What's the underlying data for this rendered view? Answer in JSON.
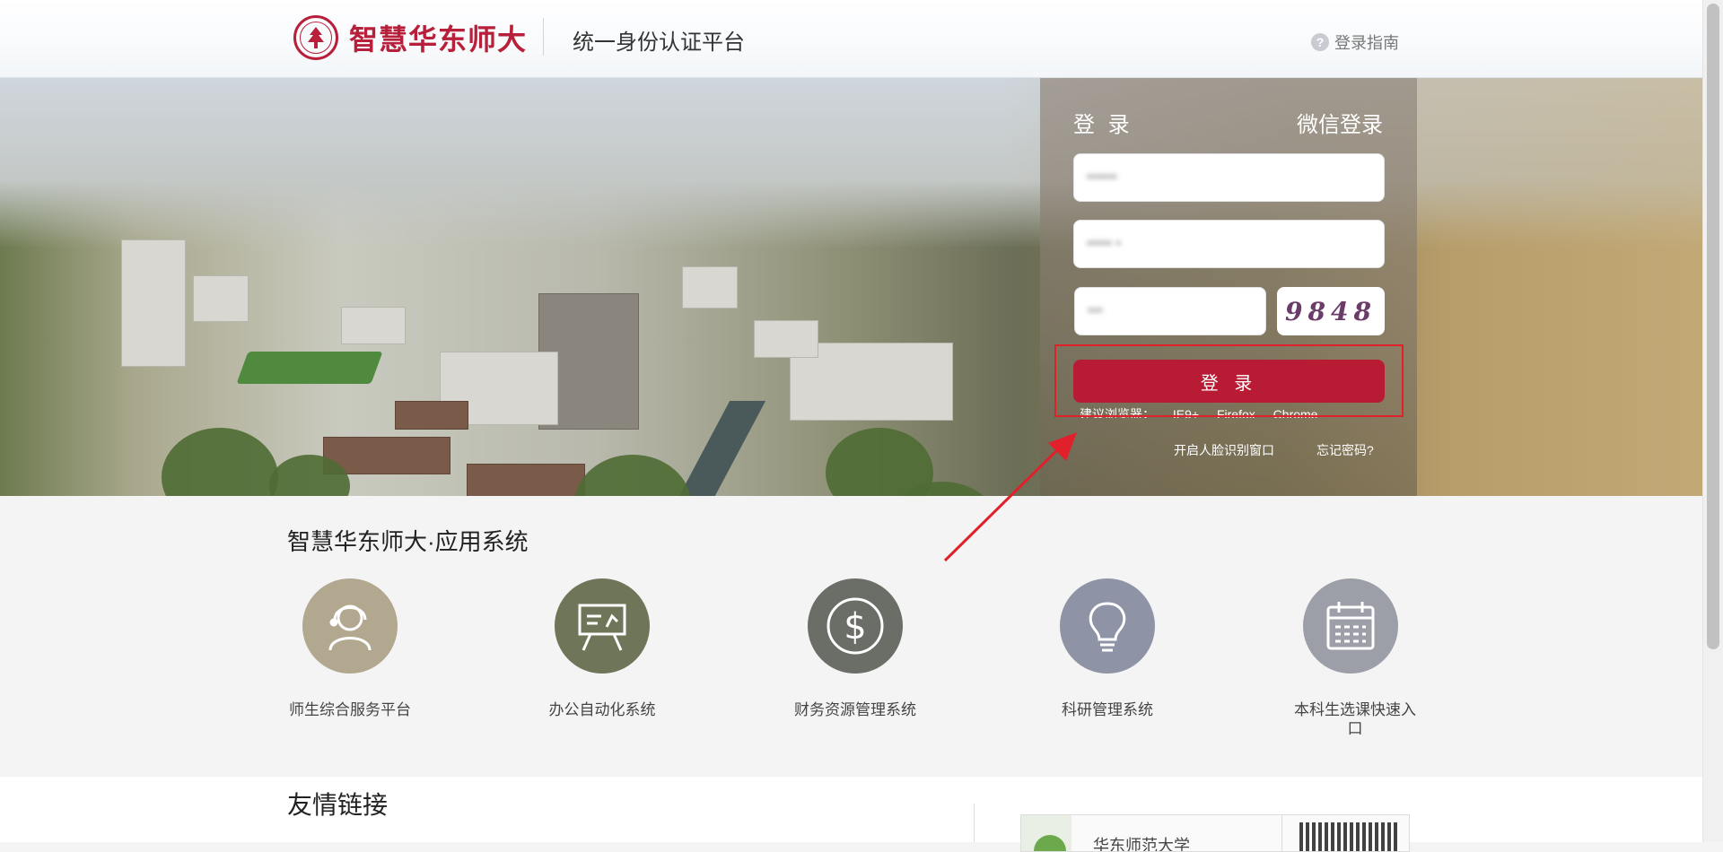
{
  "header": {
    "logo_text": "智慧华东师大",
    "platform_title": "统一身份认证平台",
    "guide_label": "登录指南"
  },
  "login": {
    "tab_login": "登 录",
    "tab_wechat": "微信登录",
    "username_value": "••••••",
    "password_value": "•••••  •",
    "captcha_value": "•••",
    "captcha_image_text": "9848",
    "login_button": "登 录",
    "browser_tip": [
      "建议浏览器：",
      "IE9+",
      "Firefox",
      "Chrome"
    ],
    "face_link": "开启人脸识别窗口",
    "forgot_link": "忘记密码?"
  },
  "apps": {
    "title": "智慧华东师大·应用系统",
    "items": [
      {
        "label": "师生综合服务平台",
        "icon": "service-person-icon",
        "color": "#b1a88f"
      },
      {
        "label": "办公自动化系统",
        "icon": "presentation-icon",
        "color": "#6f7558"
      },
      {
        "label": "财务资源管理系统",
        "icon": "dollar-icon",
        "color": "#6b6e67"
      },
      {
        "label": "科研管理系统",
        "icon": "lightbulb-icon",
        "color": "#8e93a6"
      },
      {
        "label": "本科生选课快速入口",
        "icon": "calendar-icon",
        "color": "#9c9ea8"
      }
    ]
  },
  "friends": {
    "title": "友情链接",
    "card_text": "华东师范大学"
  },
  "colors": {
    "brand": "#b81b34",
    "highlight": "#e0202a"
  }
}
